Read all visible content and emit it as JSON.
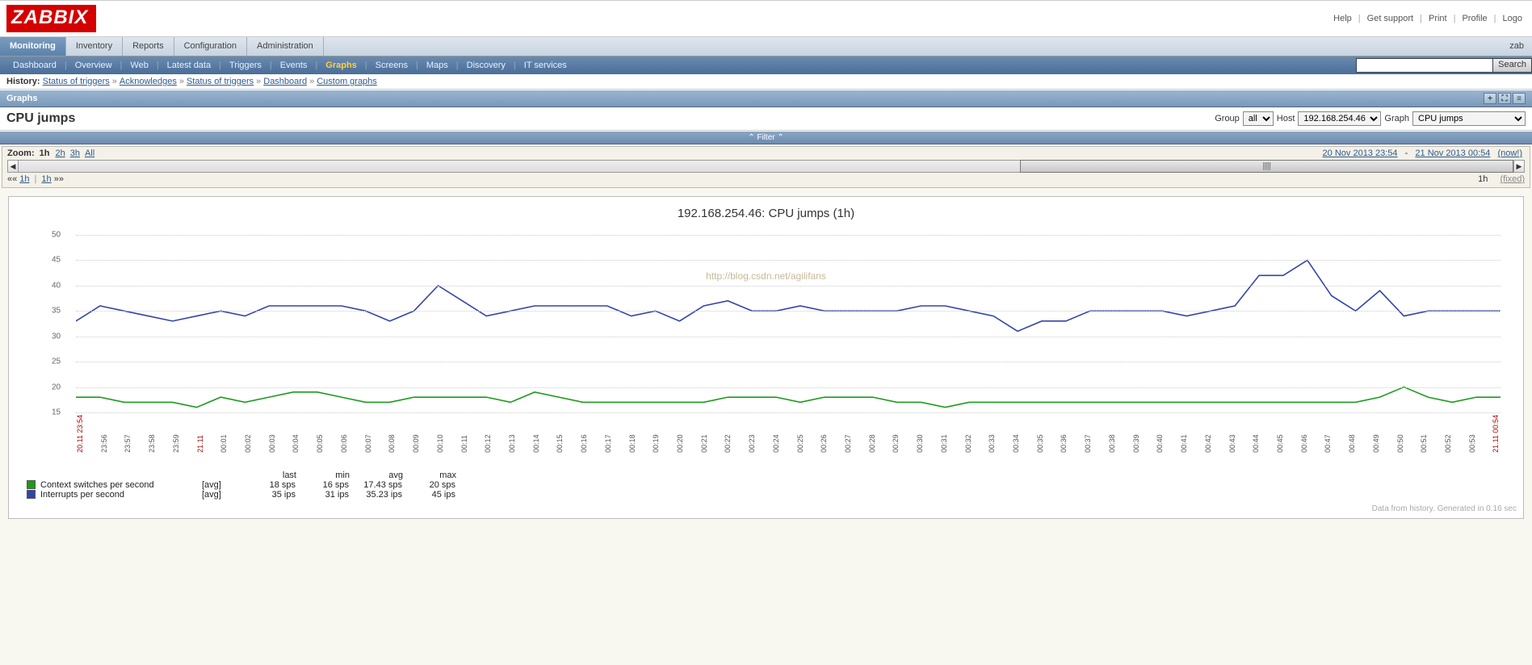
{
  "logo_text": "ZABBIX",
  "top_links": [
    "Help",
    "Get support",
    "Print",
    "Profile",
    "Logo"
  ],
  "main_tabs": [
    "Monitoring",
    "Inventory",
    "Reports",
    "Configuration",
    "Administration"
  ],
  "main_tabs_active": 0,
  "right_corner_text": "zab",
  "sub_tabs": [
    "Dashboard",
    "Overview",
    "Web",
    "Latest data",
    "Triggers",
    "Events",
    "Graphs",
    "Screens",
    "Maps",
    "Discovery",
    "IT services"
  ],
  "sub_tabs_active": 6,
  "search_btn": "Search",
  "history_label": "History:",
  "history": [
    "Status of triggers",
    "Acknowledges",
    "Status of triggers",
    "Dashboard",
    "Custom graphs"
  ],
  "section_title": "Graphs",
  "page_title": "CPU jumps",
  "selectors": {
    "group_label": "Group",
    "group_value": "all",
    "host_label": "Host",
    "host_value": "192.168.254.46",
    "graph_label": "Graph",
    "graph_value": "CPU jumps"
  },
  "filter_label": "⌃ Filter ⌃",
  "zoom": {
    "label": "Zoom:",
    "current": "1h",
    "options": [
      "2h",
      "3h",
      "All"
    ],
    "date_from": "20 Nov 2013 23:54",
    "date_to": "21 Nov 2013 00:54",
    "now_label": "(now!)",
    "nav_back": "1h",
    "nav_fwd": "1h",
    "duration": "1h",
    "fixed": "(fixed)"
  },
  "chart_data": {
    "type": "line",
    "title": "192.168.254.46: CPU jumps (1h)",
    "ylim": [
      15,
      50
    ],
    "y_ticks": [
      15,
      20,
      25,
      30,
      35,
      40,
      45,
      50
    ],
    "x_labels": [
      "20.11 23:54",
      "23:56",
      "23:57",
      "23:58",
      "23:59",
      "21.11",
      "00:01",
      "00:02",
      "00:03",
      "00:04",
      "00:05",
      "00:06",
      "00:07",
      "00:08",
      "00:09",
      "00:10",
      "00:11",
      "00:12",
      "00:13",
      "00:14",
      "00:15",
      "00:16",
      "00:17",
      "00:18",
      "00:19",
      "00:20",
      "00:21",
      "00:22",
      "00:23",
      "00:24",
      "00:25",
      "00:26",
      "00:27",
      "00:28",
      "00:29",
      "00:30",
      "00:31",
      "00:32",
      "00:33",
      "00:34",
      "00:35",
      "00:36",
      "00:37",
      "00:38",
      "00:39",
      "00:40",
      "00:41",
      "00:42",
      "00:43",
      "00:44",
      "00:45",
      "00:46",
      "00:47",
      "00:48",
      "00:49",
      "00:50",
      "00:51",
      "00:52",
      "00:53",
      "21.11 00:54"
    ],
    "x_red": [
      0,
      5,
      59
    ],
    "series": [
      {
        "name": "Context switches per second",
        "color": "#1a9c1a",
        "agg": "[avg]",
        "stats": {
          "last": "18 sps",
          "min": "16 sps",
          "avg": "17.43 sps",
          "max": "20 sps"
        },
        "values": [
          18,
          18,
          17,
          17,
          17,
          16,
          18,
          17,
          18,
          19,
          19,
          18,
          17,
          17,
          18,
          18,
          18,
          18,
          17,
          19,
          18,
          17,
          17,
          17,
          17,
          17,
          17,
          18,
          18,
          18,
          17,
          18,
          18,
          18,
          17,
          17,
          16,
          17,
          17,
          17,
          17,
          17,
          17,
          17,
          17,
          17,
          17,
          17,
          17,
          17,
          17,
          17,
          17,
          17,
          18,
          20,
          18,
          17,
          18,
          18
        ]
      },
      {
        "name": "Interrupts per second",
        "color": "#3344aa",
        "agg": "[avg]",
        "stats": {
          "last": "35 ips",
          "min": "31 ips",
          "avg": "35.23 ips",
          "max": "45 ips"
        },
        "values": [
          33,
          36,
          35,
          34,
          33,
          34,
          35,
          34,
          36,
          36,
          36,
          36,
          35,
          33,
          35,
          40,
          37,
          34,
          35,
          36,
          36,
          36,
          36,
          34,
          35,
          33,
          36,
          37,
          35,
          35,
          36,
          35,
          35,
          35,
          35,
          36,
          36,
          35,
          34,
          31,
          33,
          33,
          35,
          35,
          35,
          35,
          34,
          35,
          36,
          42,
          42,
          45,
          38,
          35,
          39,
          34,
          35,
          35,
          35,
          35
        ]
      }
    ],
    "stat_headers": [
      "last",
      "min",
      "avg",
      "max"
    ]
  },
  "watermark": "http://blog.csdn.net/agilifans",
  "footer": "Data from history. Generated in 0.16 sec"
}
